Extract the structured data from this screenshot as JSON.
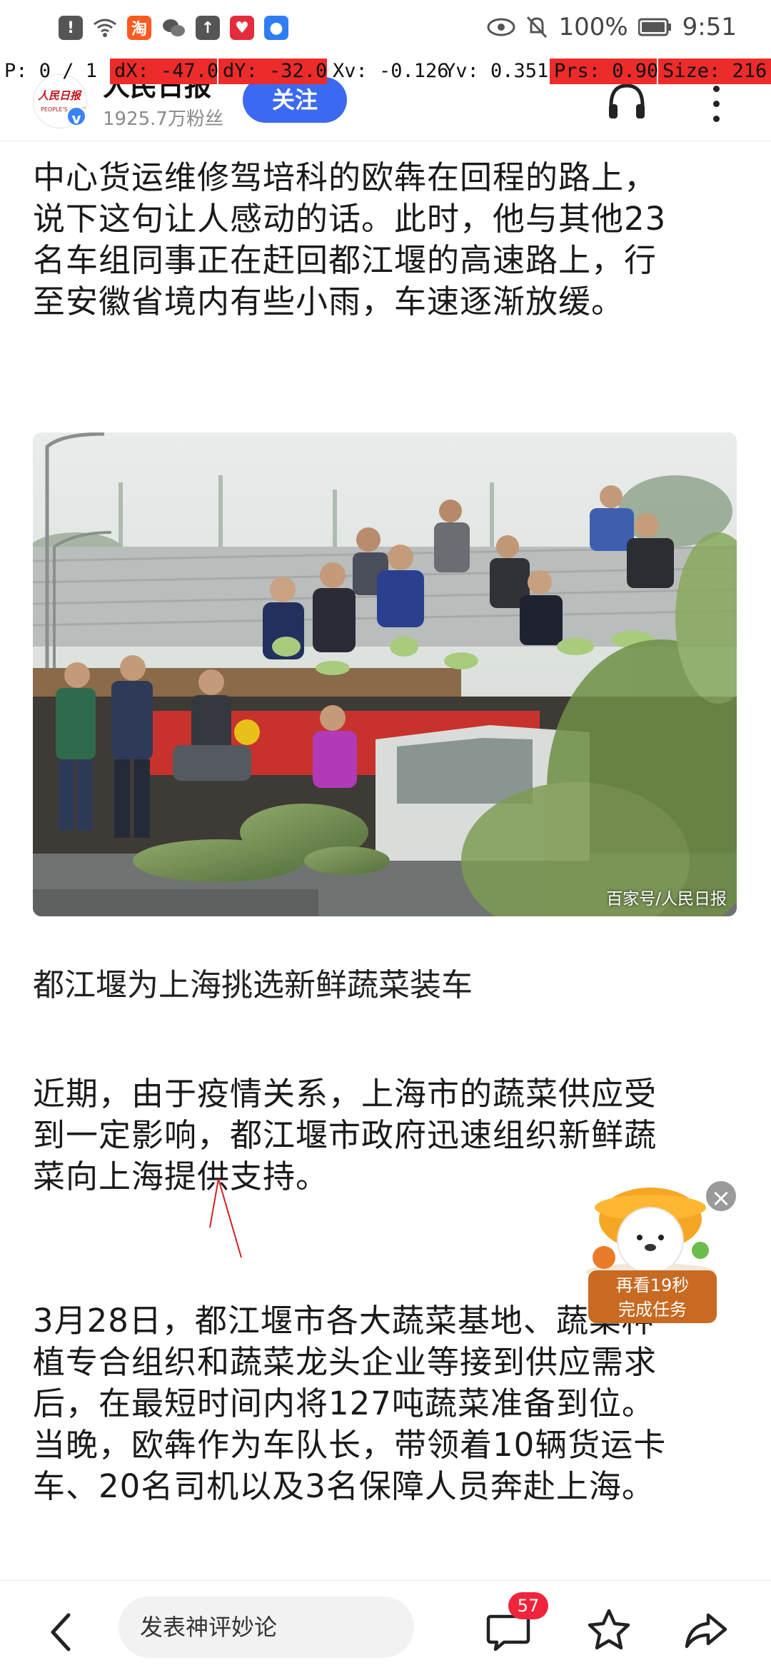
{
  "status_bar": {
    "battery": "100%",
    "time": "9:51",
    "app_icons": [
      "alert-icon",
      "wifi-question-icon",
      "taobao-icon",
      "wechat-icon",
      "upload-icon",
      "heart-app-icon",
      "bulb-app-icon"
    ]
  },
  "pointer_overlay": {
    "p": "P: 0 / 1",
    "dx": "dX: -47.0",
    "dy": "dY: -32.0",
    "xv": "Xv: -0.126",
    "yv": "Yv: 0.351",
    "prs": "Prs: 0.90",
    "size": "Size: 216.0"
  },
  "header": {
    "logo_text": "人民日报",
    "logo_sub": "PEOPLE'S DAILY",
    "account_name": "人民日报",
    "fans": "1925.7万粉丝",
    "follow_label": "关注"
  },
  "article": {
    "para1_lines": [
      "中心货运维修驾培科的欧犇在回程的路上，",
      "说下这句让人感动的话。此时，他与其他23",
      "名车组同事正在赶回都江堰的高速路上，行",
      "至安徽省境内有些小雨，车速逐渐放缓。"
    ],
    "photo_credit": "百家号/人民日报",
    "caption": "都江堰为上海挑选新鲜蔬菜装车",
    "para2_lines": [
      "近期，由于疫情关系，上海市的蔬菜供应受",
      "到一定影响，都江堰市政府迅速组织新鲜蔬",
      "菜向上海提供支持。"
    ],
    "para3_lines": [
      "3月28日，都江堰市各大蔬菜基地、蔬菜种",
      "植专合组织和蔬菜龙头企业等接到供应需求",
      "后，在最短时间内将127吨蔬菜准备到位。",
      "当晚，欧犇作为车队长，带领着10辆货运卡",
      "车、20名司机以及3名保障人员奔赴上海。"
    ]
  },
  "task_widget": {
    "line1": "再看19秒",
    "line2": "完成任务"
  },
  "bottom_bar": {
    "comment_placeholder": "发表神评妙论",
    "comment_count": "57"
  }
}
